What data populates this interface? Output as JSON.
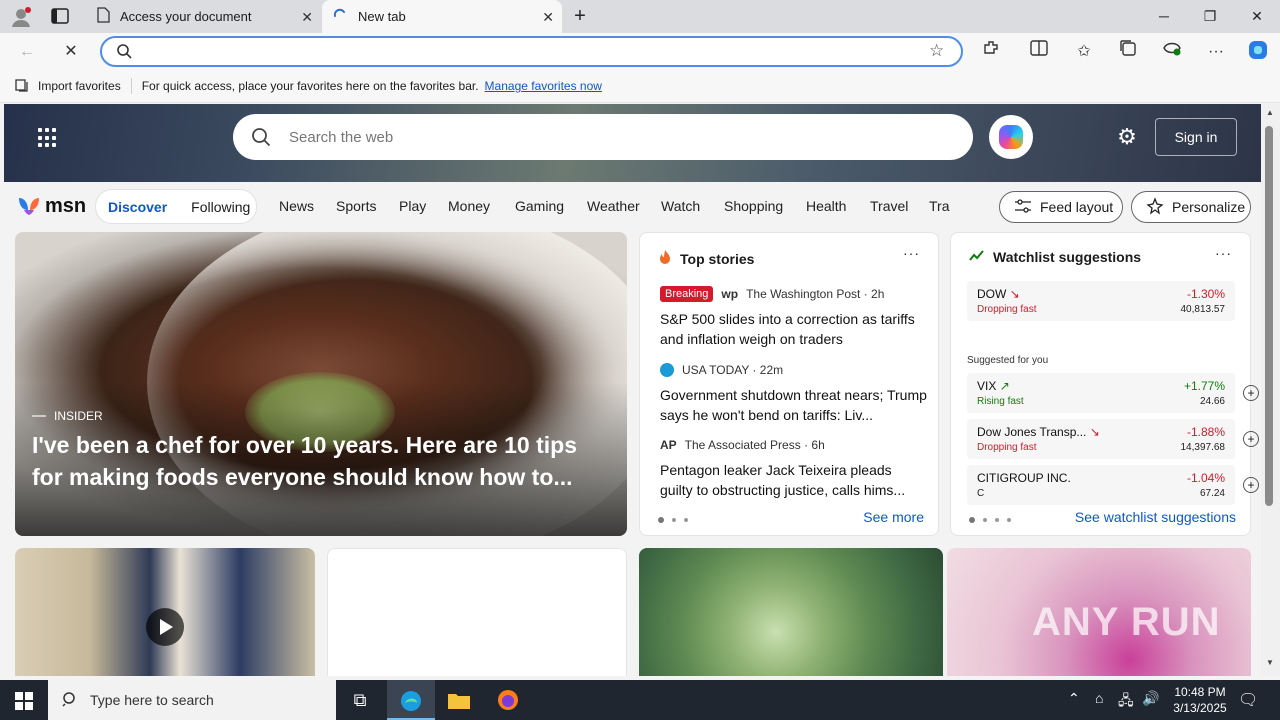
{
  "browser": {
    "tabs": [
      {
        "title": "Access your document"
      },
      {
        "title": "New tab"
      }
    ],
    "window_controls": {
      "minimize": "─",
      "restore": "❐",
      "close": "✕"
    },
    "favorites_bar": {
      "import_label": "Import favorites",
      "hint": "For quick access, place your favorites here on the favorites bar.",
      "manage_link": "Manage favorites now"
    }
  },
  "msn": {
    "search_placeholder": "Search the web",
    "sign_in": "Sign in",
    "logo_text": "msn",
    "pills": [
      "Discover",
      "Following"
    ],
    "nav": [
      "News",
      "Sports",
      "Play",
      "Money",
      "Gaming",
      "Weather",
      "Watch",
      "Shopping",
      "Health",
      "Travel",
      "Tra"
    ],
    "feed_layout": "Feed layout",
    "personalize": "Personalize",
    "feature": {
      "source": "INSIDER",
      "headline": "I've been a chef for over 10 years. Here are 10 tips for making foods everyone should know how to..."
    },
    "top_stories": {
      "title": "Top stories",
      "more": "···",
      "see_more": "See more",
      "stories": [
        {
          "badge": "Breaking",
          "source": "The Washington Post · 2h",
          "title": "S&P 500 slides into a correction as tariffs and inflation weigh on traders"
        },
        {
          "badge": "",
          "source": "USA TODAY · 22m",
          "title": "Government shutdown threat nears; Trump says he won't bend on tariffs: Liv..."
        },
        {
          "badge": "",
          "source": "The Associated Press · 6h",
          "title": "Pentagon leaker Jack Teixeira pleads guilty to obstructing justice, calls hims..."
        }
      ]
    },
    "watchlist": {
      "title": "Watchlist suggestions",
      "more": "···",
      "suggested_label": "Suggested for you",
      "see_link": "See watchlist suggestions",
      "rows": [
        {
          "name": "DOW",
          "sub": "Dropping fast",
          "pct": "-1.30%",
          "price": "40,813.57",
          "trend": "down"
        },
        {
          "name": "VIX",
          "sub": "Rising fast",
          "pct": "+1.77%",
          "price": "24.66",
          "trend": "up"
        },
        {
          "name": "Dow Jones Transp...",
          "sub": "Dropping fast",
          "pct": "-1.88%",
          "price": "14,397.68",
          "trend": "down"
        },
        {
          "name": "CITIGROUP INC.",
          "sub": "C",
          "pct": "-1.04%",
          "price": "67.24",
          "trend": "down"
        }
      ],
      "plus": "+"
    },
    "watermark": "ANY RUN"
  },
  "taskbar": {
    "search_placeholder": "Type here to search",
    "time": "10:48 PM",
    "date": "3/13/2025"
  },
  "colors": {
    "accent": "#0f58c7",
    "address_focus": "#4f8ee8",
    "negative": "#d41b2c",
    "positive": "#107c10"
  }
}
